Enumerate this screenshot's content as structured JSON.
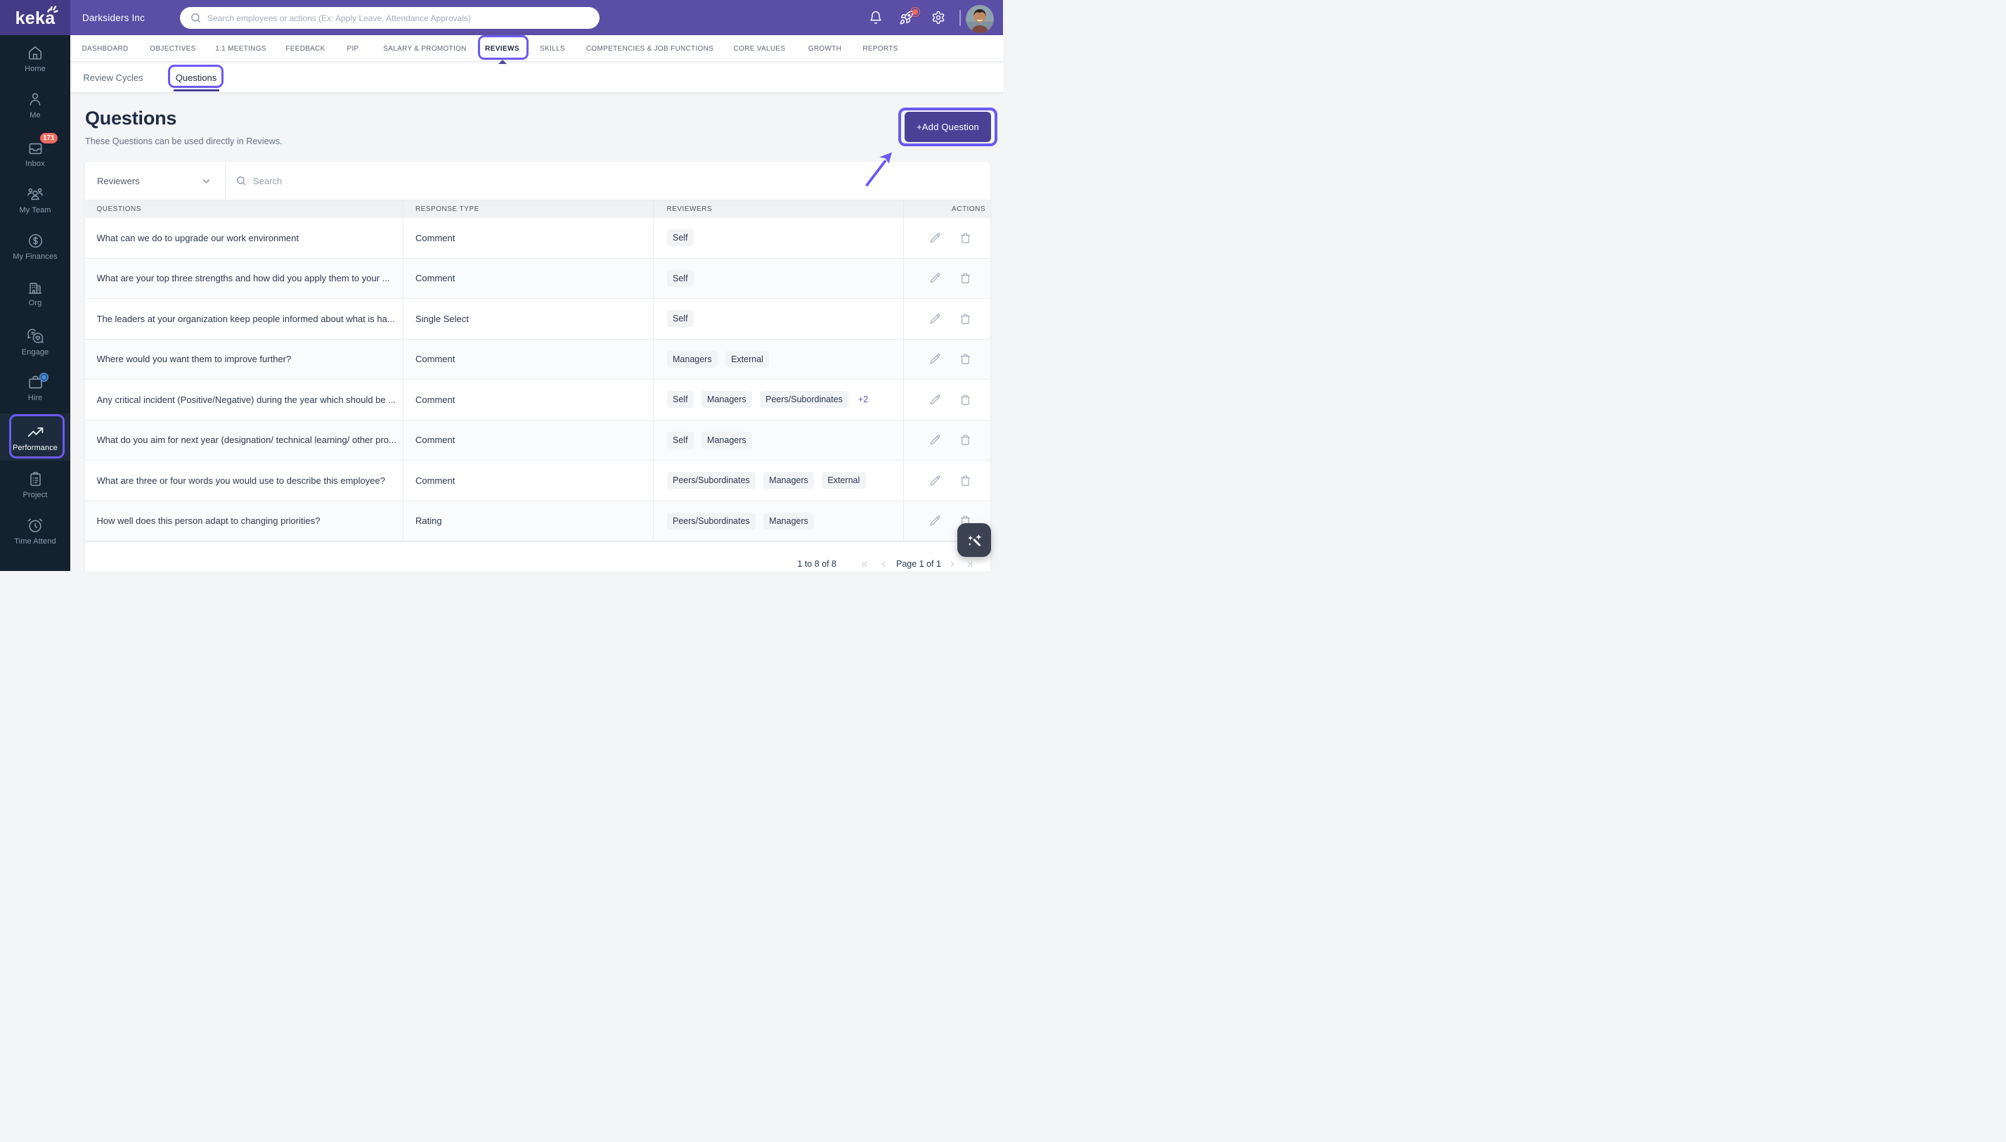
{
  "brand": {
    "logo_text": "keka",
    "company_name": "Darksiders Inc"
  },
  "header": {
    "search_placeholder": "Search employees or actions (Ex: Apply Leave, Attendance Approvals)"
  },
  "sidebar": {
    "items": [
      {
        "id": "home",
        "label": "Home",
        "icon": "home-icon"
      },
      {
        "id": "me",
        "label": "Me",
        "icon": "user-icon"
      },
      {
        "id": "inbox",
        "label": "Inbox",
        "icon": "inbox-icon",
        "badge": "171"
      },
      {
        "id": "my-team",
        "label": "My Team",
        "icon": "team-icon"
      },
      {
        "id": "my-finances",
        "label": "My Finances",
        "icon": "dollar-circle-icon"
      },
      {
        "id": "org",
        "label": "Org",
        "icon": "building-icon"
      },
      {
        "id": "engage",
        "label": "Engage",
        "icon": "chat-heart-icon"
      },
      {
        "id": "hire",
        "label": "Hire",
        "icon": "briefcase-icon",
        "dot": true
      },
      {
        "id": "performance",
        "label": "Performance",
        "icon": "trending-up-icon",
        "active": true,
        "annotated": true
      },
      {
        "id": "project",
        "label": "Project",
        "icon": "clipboard-icon"
      },
      {
        "id": "time-attend",
        "label": "Time Attend",
        "icon": "alarm-clock-icon"
      }
    ]
  },
  "nav_tabs": {
    "active": "REVIEWS",
    "items": [
      "DASHBOARD",
      "OBJECTIVES",
      "1:1 MEETINGS",
      "FEEDBACK",
      "PIP",
      "SALARY & PROMOTION",
      "REVIEWS",
      "SKILLS",
      "COMPETENCIES & JOB FUNCTIONS",
      "CORE VALUES",
      "GROWTH",
      "REPORTS"
    ]
  },
  "sub_tabs": {
    "active": "Questions",
    "items": [
      "Review Cycles",
      "Questions"
    ]
  },
  "page": {
    "title": "Questions",
    "subtitle": "These Questions can be used directly in Reviews.",
    "add_button_label": "+Add Question"
  },
  "filters": {
    "reviewers_label": "Reviewers",
    "search_placeholder": "Search"
  },
  "table": {
    "columns": [
      "QUESTIONS",
      "RESPONSE TYPE",
      "REVIEWERS",
      "ACTIONS"
    ],
    "rows": [
      {
        "question": "What can we do to upgrade our work environment",
        "response_type": "Comment",
        "reviewers": [
          "Self"
        ]
      },
      {
        "question": "What are your top three strengths and how did you apply them to your ...",
        "response_type": "Comment",
        "reviewers": [
          "Self"
        ]
      },
      {
        "question": "The leaders at your organization keep people informed about what is ha...",
        "response_type": "Single Select",
        "reviewers": [
          "Self"
        ]
      },
      {
        "question": "Where would you want them to improve further?",
        "response_type": "Comment",
        "reviewers": [
          "Managers",
          "External"
        ]
      },
      {
        "question": "Any critical incident (Positive/Negative) during the year which should be ...",
        "response_type": "Comment",
        "reviewers": [
          "Self",
          "Managers",
          "Peers/Subordinates"
        ],
        "extra": "+2"
      },
      {
        "question": "What do you aim for next year (designation/ technical learning/ other pro...",
        "response_type": "Comment",
        "reviewers": [
          "Self",
          "Managers"
        ]
      },
      {
        "question": "What are three or four words you would use to describe this employee?",
        "response_type": "Comment",
        "reviewers": [
          "Peers/Subordinates",
          "Managers",
          "External"
        ]
      },
      {
        "question": "How well does this person adapt to changing priorities?",
        "response_type": "Rating",
        "reviewers": [
          "Peers/Subordinates",
          "Managers"
        ]
      }
    ]
  },
  "pagination": {
    "range_text": "1 to 8 of 8",
    "page_text": "Page 1 of 1"
  },
  "colors": {
    "header_purple": "#5a4ea6",
    "logo_block_purple": "#443a86",
    "annotation_purple": "#6c5af0",
    "button_purple": "#4b4095",
    "sidebar_bg": "#14212f",
    "badge_red": "#ec6a5f",
    "hire_dot_blue": "#4a90d9",
    "content_bg": "#f4f5f7"
  }
}
